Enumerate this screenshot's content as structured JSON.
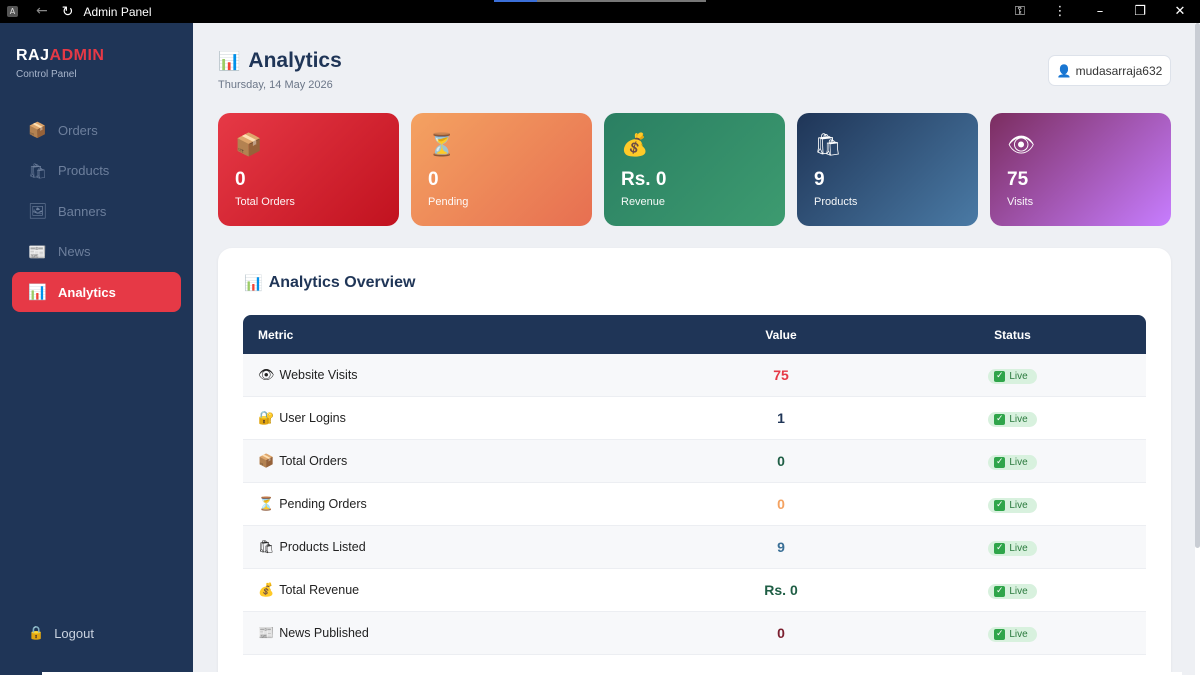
{
  "window": {
    "title": "Admin Panel",
    "app_icon": "A"
  },
  "sidebar": {
    "brand_prefix": "RAJ",
    "brand_suffix": "ADMIN",
    "subtitle": "Control Panel",
    "items": [
      {
        "label": "Orders",
        "icon": "📦",
        "icon_name": "box-icon"
      },
      {
        "label": "Products",
        "icon": "🛍",
        "icon_name": "shopping-bags-icon"
      },
      {
        "label": "Banners",
        "icon": "🖼",
        "icon_name": "picture-icon"
      },
      {
        "label": "News",
        "icon": "📰",
        "icon_name": "newspaper-icon"
      },
      {
        "label": "Analytics",
        "icon": "📊",
        "icon_name": "bar-chart-icon",
        "active": true
      }
    ],
    "logout_label": "Logout",
    "logout_icon": "🔒"
  },
  "header": {
    "title": "Analytics",
    "title_icon": "📊",
    "date": "Thursday, 14 May 2026",
    "username": "mudasarraja632",
    "user_icon": "👤"
  },
  "cards": [
    {
      "icon": "📦",
      "value": "0",
      "label": "Total Orders"
    },
    {
      "icon": "⏳",
      "value": "0",
      "label": "Pending"
    },
    {
      "icon": "💰",
      "value": "Rs. 0",
      "label": "Revenue"
    },
    {
      "icon": "🛍",
      "value": "9",
      "label": "Products"
    },
    {
      "icon": "👁",
      "value": "75",
      "label": "Visits"
    }
  ],
  "overview": {
    "title": "Analytics Overview",
    "title_icon": "📊",
    "columns": [
      "Metric",
      "Value",
      "Status"
    ],
    "rows": [
      {
        "icon": "👁",
        "metric": "Website Visits",
        "value": "75",
        "color": "#e63946",
        "status": "Live"
      },
      {
        "icon": "🔐",
        "metric": "User Logins",
        "value": "1",
        "color": "#1f3557",
        "status": "Live"
      },
      {
        "icon": "📦",
        "metric": "Total Orders",
        "value": "0",
        "color": "#1f5e45",
        "status": "Live"
      },
      {
        "icon": "⏳",
        "metric": "Pending Orders",
        "value": "0",
        "color": "#f4a261",
        "status": "Live"
      },
      {
        "icon": "🛍",
        "metric": "Products Listed",
        "value": "9",
        "color": "#3a6f96",
        "status": "Live"
      },
      {
        "icon": "💰",
        "metric": "Total Revenue",
        "value": "Rs. 0",
        "color": "#1f5e45",
        "status": "Live"
      },
      {
        "icon": "📰",
        "metric": "News Published",
        "value": "0",
        "color": "#7b1f2f",
        "status": "Live"
      }
    ]
  }
}
